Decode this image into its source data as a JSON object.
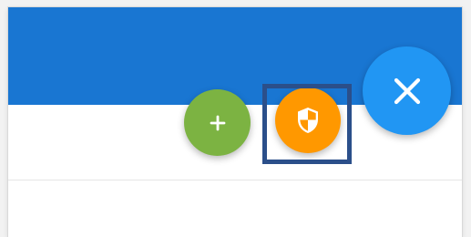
{
  "colors": {
    "app_bar": "#1976d2",
    "add_button": "#7cb342",
    "security_button": "#ff9800",
    "close_button": "#2196f3",
    "highlight_border": "#2b4f8a"
  },
  "buttons": [
    {
      "name": "add-button",
      "icon": "plus-icon"
    },
    {
      "name": "security-button",
      "icon": "shield-icon"
    },
    {
      "name": "close-button",
      "icon": "close-icon"
    }
  ]
}
